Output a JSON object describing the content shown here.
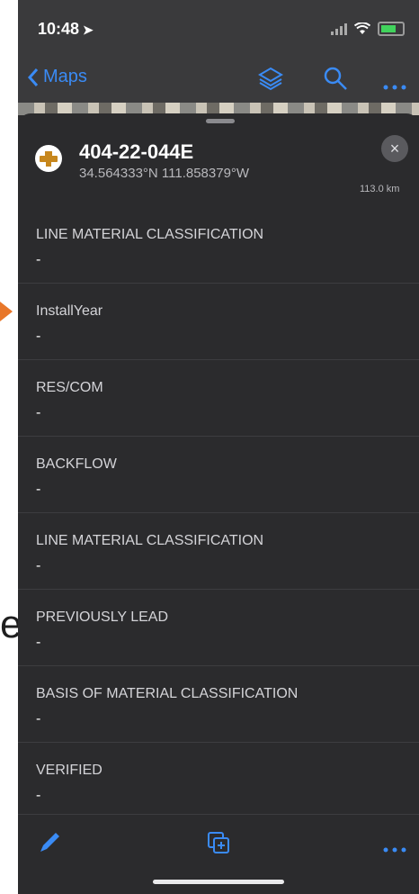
{
  "status_bar": {
    "time": "10:48"
  },
  "nav": {
    "back_label": "Maps"
  },
  "feature": {
    "id": "404-22-044E",
    "coords": "34.564333°N 111.858379°W",
    "distance": "113.0 km",
    "close_glyph": "×"
  },
  "fields": [
    {
      "label": "LINE MATERIAL CLASSIFICATION",
      "value": "-"
    },
    {
      "label": "InstallYear",
      "value": "-"
    },
    {
      "label": "RES/COM",
      "value": "-"
    },
    {
      "label": "BACKFLOW",
      "value": "-"
    },
    {
      "label": "LINE MATERIAL CLASSIFICATION",
      "value": "-"
    },
    {
      "label": "PREVIOUSLY LEAD",
      "value": "-"
    },
    {
      "label": "BASIS OF MATERIAL CLASSIFICATION",
      "value": "-"
    },
    {
      "label": "VERIFIED",
      "value": "-"
    }
  ],
  "annotation": {
    "letter": "e"
  },
  "colors": {
    "accent": "#3a8bf5",
    "panel": "#2b2b2d",
    "arrow": "#e8772a"
  },
  "icons": [
    "location-arrow-icon",
    "signal-icon",
    "wifi-icon",
    "battery-icon",
    "chevron-left-icon",
    "layers-icon",
    "search-icon",
    "more-icon",
    "feature-symbol-icon",
    "close-icon",
    "edit-icon",
    "copy-add-icon"
  ]
}
